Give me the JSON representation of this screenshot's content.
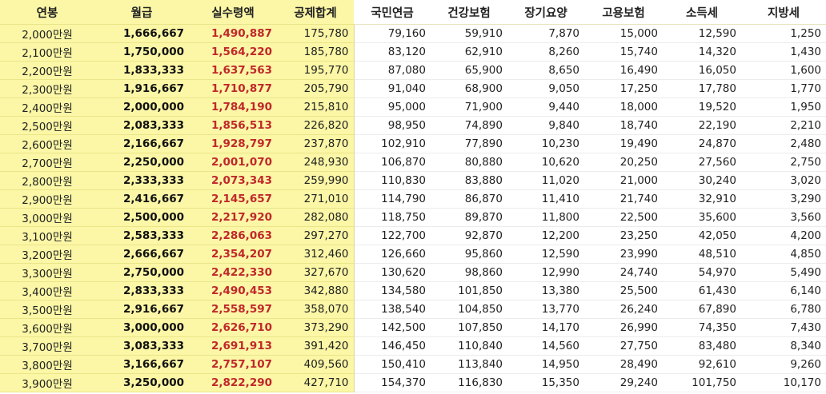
{
  "headers": [
    "연봉",
    "월급",
    "실수령액",
    "공제합계",
    "국민연금",
    "건강보험",
    "장기요양",
    "고용보험",
    "소득세",
    "지방세"
  ],
  "rows": [
    [
      "2,000만원",
      "1,666,667",
      "1,490,887",
      "175,780",
      "79,160",
      "59,910",
      "7,870",
      "15,000",
      "12,590",
      "1,250"
    ],
    [
      "2,100만원",
      "1,750,000",
      "1,564,220",
      "185,780",
      "83,120",
      "62,910",
      "8,260",
      "15,740",
      "14,320",
      "1,430"
    ],
    [
      "2,200만원",
      "1,833,333",
      "1,637,563",
      "195,770",
      "87,080",
      "65,900",
      "8,650",
      "16,490",
      "16,050",
      "1,600"
    ],
    [
      "2,300만원",
      "1,916,667",
      "1,710,877",
      "205,790",
      "91,040",
      "68,900",
      "9,050",
      "17,250",
      "17,780",
      "1,770"
    ],
    [
      "2,400만원",
      "2,000,000",
      "1,784,190",
      "215,810",
      "95,000",
      "71,900",
      "9,440",
      "18,000",
      "19,520",
      "1,950"
    ],
    [
      "2,500만원",
      "2,083,333",
      "1,856,513",
      "226,820",
      "98,950",
      "74,890",
      "9,840",
      "18,740",
      "22,190",
      "2,210"
    ],
    [
      "2,600만원",
      "2,166,667",
      "1,928,797",
      "237,870",
      "102,910",
      "77,890",
      "10,230",
      "19,490",
      "24,870",
      "2,480"
    ],
    [
      "2,700만원",
      "2,250,000",
      "2,001,070",
      "248,930",
      "106,870",
      "80,880",
      "10,620",
      "20,250",
      "27,560",
      "2,750"
    ],
    [
      "2,800만원",
      "2,333,333",
      "2,073,343",
      "259,990",
      "110,830",
      "83,880",
      "11,020",
      "21,000",
      "30,240",
      "3,020"
    ],
    [
      "2,900만원",
      "2,416,667",
      "2,145,657",
      "271,010",
      "114,790",
      "86,870",
      "11,410",
      "21,740",
      "32,910",
      "3,290"
    ],
    [
      "3,000만원",
      "2,500,000",
      "2,217,920",
      "282,080",
      "118,750",
      "89,870",
      "11,800",
      "22,500",
      "35,600",
      "3,560"
    ],
    [
      "3,100만원",
      "2,583,333",
      "2,286,063",
      "297,270",
      "122,700",
      "92,870",
      "12,200",
      "23,250",
      "42,050",
      "4,200"
    ],
    [
      "3,200만원",
      "2,666,667",
      "2,354,207",
      "312,460",
      "126,660",
      "95,860",
      "12,590",
      "23,990",
      "48,510",
      "4,850"
    ],
    [
      "3,300만원",
      "2,750,000",
      "2,422,330",
      "327,670",
      "130,620",
      "98,860",
      "12,990",
      "24,740",
      "54,970",
      "5,490"
    ],
    [
      "3,400만원",
      "2,833,333",
      "2,490,453",
      "342,880",
      "134,580",
      "101,850",
      "13,380",
      "25,500",
      "61,430",
      "6,140"
    ],
    [
      "3,500만원",
      "2,916,667",
      "2,558,597",
      "358,070",
      "138,540",
      "104,850",
      "13,770",
      "26,240",
      "67,890",
      "6,780"
    ],
    [
      "3,600만원",
      "3,000,000",
      "2,626,710",
      "373,290",
      "142,500",
      "107,850",
      "14,170",
      "26,990",
      "74,350",
      "7,430"
    ],
    [
      "3,700만원",
      "3,083,333",
      "2,691,913",
      "391,420",
      "146,450",
      "110,840",
      "14,560",
      "27,750",
      "83,480",
      "8,340"
    ],
    [
      "3,800만원",
      "3,166,667",
      "2,757,107",
      "409,560",
      "150,410",
      "113,840",
      "14,950",
      "28,490",
      "92,610",
      "9,260"
    ],
    [
      "3,900만원",
      "3,250,000",
      "2,822,290",
      "427,710",
      "154,370",
      "116,830",
      "15,350",
      "29,240",
      "101,750",
      "10,170"
    ]
  ],
  "colors": {
    "highlight": "#fbf7a6",
    "net_pay_text": "#c0282b"
  }
}
